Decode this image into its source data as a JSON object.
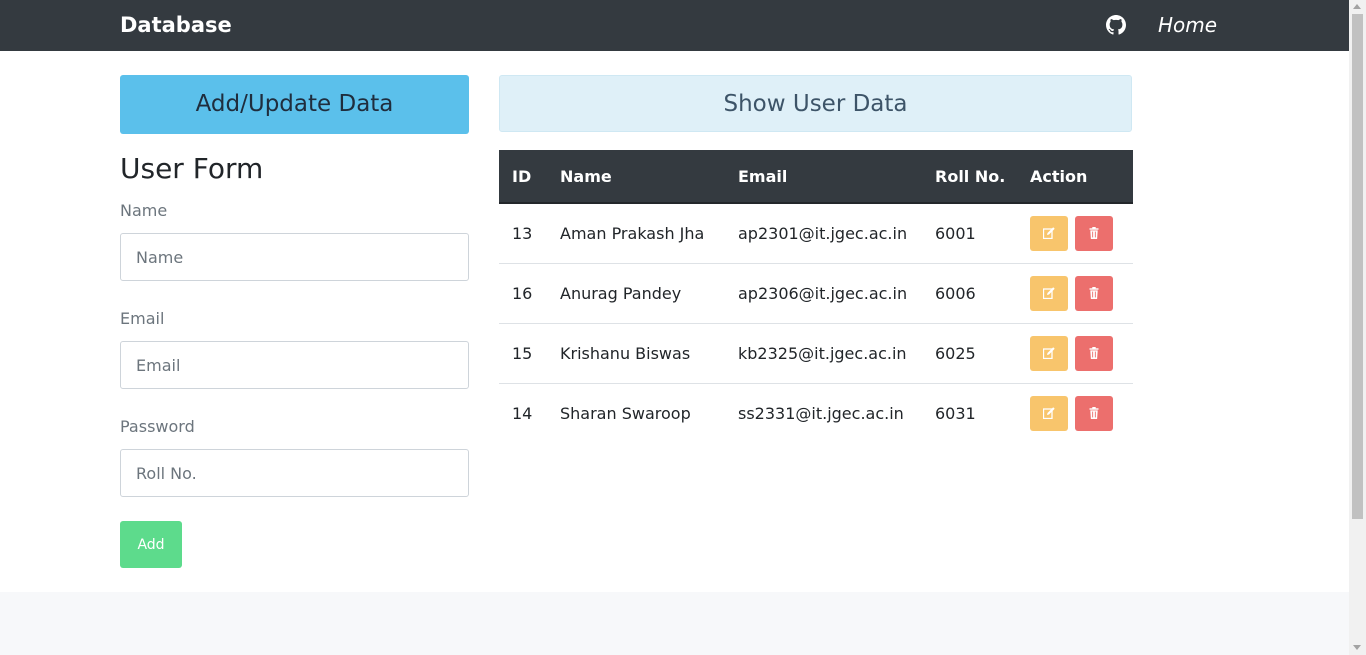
{
  "navbar": {
    "brand": "Database",
    "home_label": "Home",
    "github_icon": "github-icon"
  },
  "panel": {
    "add_update_label": "Add/Update Data",
    "show_label": "Show User Data"
  },
  "form": {
    "title": "User Form",
    "name_label": "Name",
    "name_placeholder": "Name",
    "email_label": "Email",
    "email_placeholder": "Email",
    "password_label": "Password",
    "password_placeholder": "Roll No.",
    "submit_label": "Add"
  },
  "table": {
    "headers": [
      "ID",
      "Name",
      "Email",
      "Roll No.",
      "Action"
    ],
    "rows": [
      {
        "id": "13",
        "name": "Aman Prakash Jha",
        "email": "ap2301@it.jgec.ac.in",
        "roll": "6001"
      },
      {
        "id": "16",
        "name": "Anurag Pandey",
        "email": "ap2306@it.jgec.ac.in",
        "roll": "6006"
      },
      {
        "id": "15",
        "name": "Krishanu Biswas",
        "email": "kb2325@it.jgec.ac.in",
        "roll": "6025"
      },
      {
        "id": "14",
        "name": "Sharan Swaroop",
        "email": "ss2331@it.jgec.ac.in",
        "roll": "6031"
      }
    ]
  },
  "colors": {
    "navbar": "#343a40",
    "info": "#5bc0eb",
    "success": "#5ddb8c",
    "warning": "#f8c56c",
    "danger": "#ec6f6d"
  }
}
